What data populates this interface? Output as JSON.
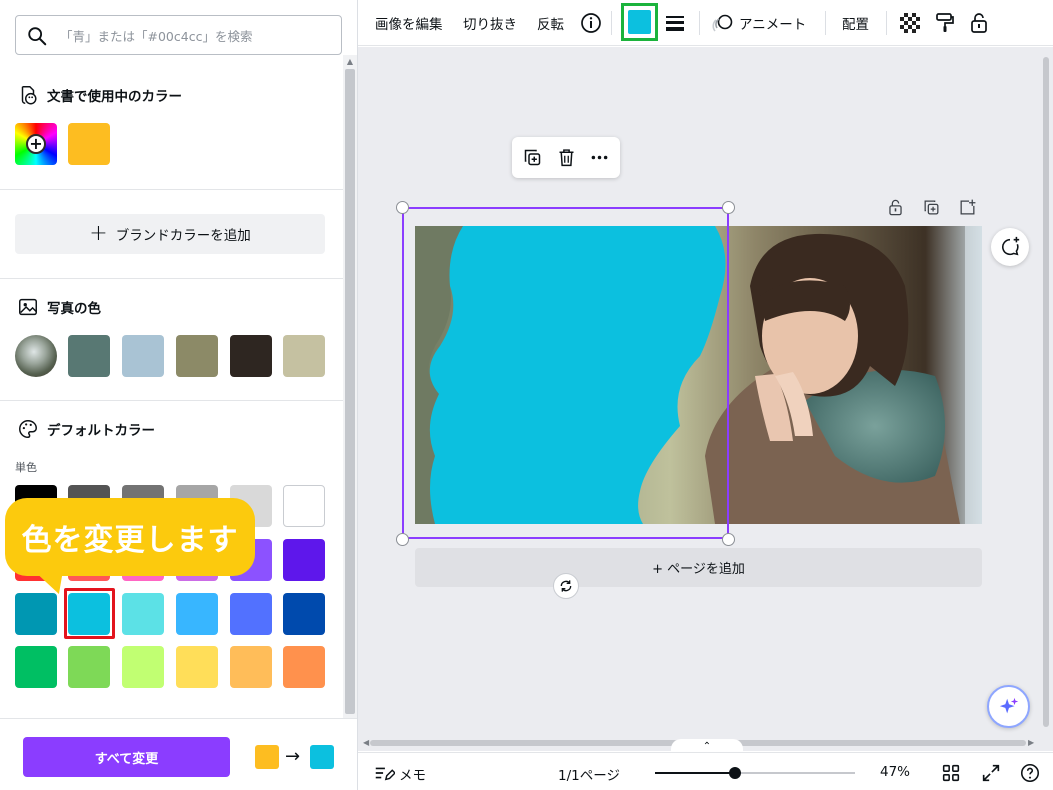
{
  "search": {
    "placeholder": "「青」または「#00c4cc」を検索",
    "value": ""
  },
  "sections": {
    "document_colors": {
      "title": "文書で使用中のカラー",
      "swatches": [
        "#fdbd21"
      ]
    },
    "brand": {
      "add_label": "ブランドカラーを追加"
    },
    "photo_colors": {
      "title": "写真の色",
      "swatches": [
        "#587873",
        "#a9c3d4",
        "#8c8a67",
        "#2e2621",
        "#c5c1a1"
      ]
    },
    "default_colors": {
      "title": "デフォルトカラー",
      "sub_label": "単色",
      "rows": [
        [
          "#000000",
          "#545454",
          "#737373",
          "#a6a6a6",
          "#d9d9d9",
          "#ffffff"
        ],
        [
          "#ff3131",
          "#ff5757",
          "#ff66c4",
          "#cb6ce6",
          "#8c52ff",
          "#5e17eb"
        ],
        [
          "#0097b2",
          "#0cc0df",
          "#5ce1e6",
          "#38b6ff",
          "#5271ff",
          "#004aad"
        ],
        [
          "#00bf63",
          "#7ed957",
          "#c1ff72",
          "#ffde59",
          "#ffbd59",
          "#ff914d"
        ]
      ],
      "selected": "#0cc0df"
    }
  },
  "callout": {
    "text": "色を変更します",
    "color": "#fcca0d"
  },
  "footer": {
    "change_all_label": "すべて変更",
    "from_color": "#fdbd21",
    "to_color": "#0cc0df",
    "arrow": "→"
  },
  "toolbar": {
    "edit_image": "画像を編集",
    "crop": "切り抜き",
    "flip": "反転",
    "animate": "アニメート",
    "position": "配置",
    "current_color": "#0cc0df"
  },
  "canvas": {
    "add_page_label": "+ ページを追加",
    "shape_color": "#0cc0df"
  },
  "bottom_bar": {
    "notes_label": "メモ",
    "page_indicator": "1/1ページ",
    "zoom_label": "47%",
    "zoom_fraction": 0.4
  },
  "colors": {
    "accent": "#8b3dff",
    "highlight": "#1bb33c",
    "selected_ring": "#e3141d"
  }
}
